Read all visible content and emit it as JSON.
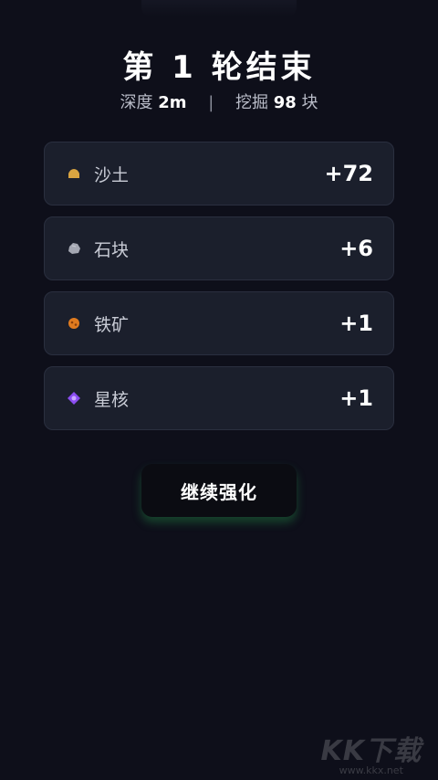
{
  "header": {
    "title": "第 1 轮结束",
    "depth_label": "深度",
    "depth_value": "2m",
    "separator": "|",
    "dig_label": "挖掘",
    "dig_value": "98",
    "dig_unit": "块"
  },
  "loot": [
    {
      "name": "沙土",
      "count": "+72",
      "icon": "sand-icon",
      "color": "#d9a441"
    },
    {
      "name": "石块",
      "count": "+6",
      "icon": "stone-icon",
      "color": "#a4a7b2"
    },
    {
      "name": "铁矿",
      "count": "+1",
      "icon": "iron-ore-icon",
      "color": "#e07b1f"
    },
    {
      "name": "星核",
      "count": "+1",
      "icon": "star-core-icon",
      "color": "#8b4df0"
    }
  ],
  "continue_button": {
    "label": "继续强化"
  },
  "watermark": {
    "main": "KK下载",
    "url": "www.kkx.net"
  },
  "colors": {
    "background": "#0e0f1a",
    "card": "#1b1f2c",
    "button_glow": "#28aa50"
  }
}
